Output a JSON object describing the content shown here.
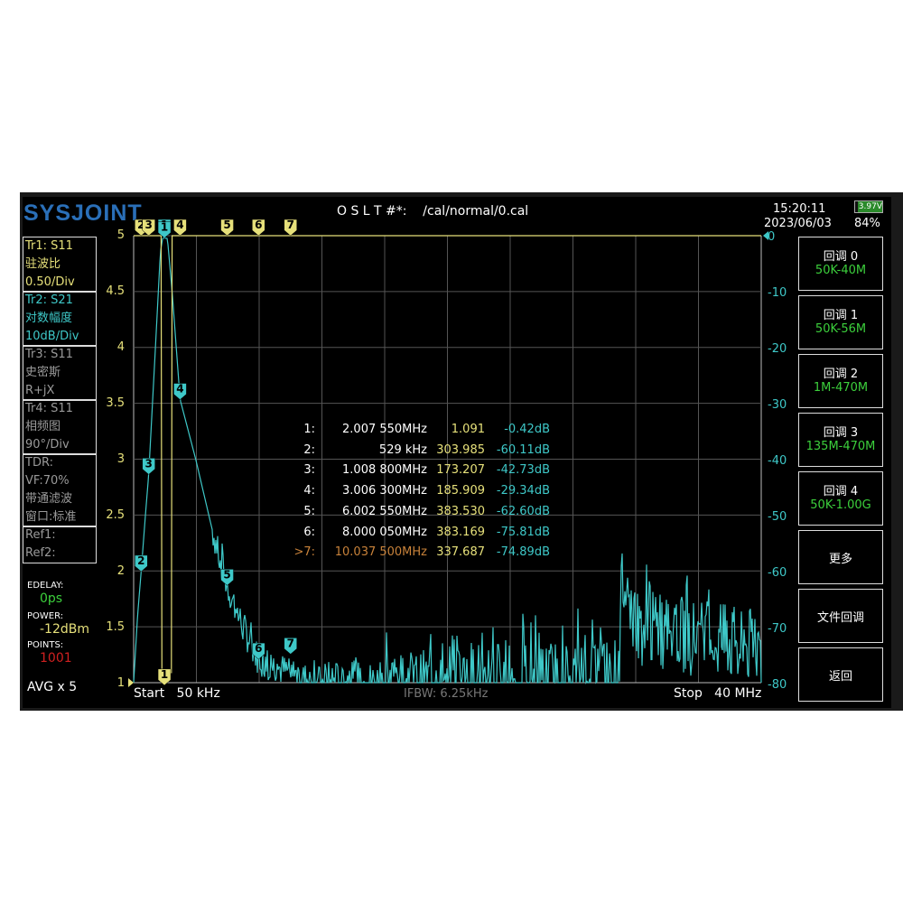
{
  "header": {
    "logo": "SYSJOINT",
    "cal_file": "O S L T #*:    /cal/normal/0.cal",
    "time": "15:20:11",
    "date": "2023/06/03",
    "battery_voltage": "3.97V",
    "battery_percent": "84%"
  },
  "traces": [
    {
      "lines": [
        "Tr1:   S11",
        "驻波比",
        "0.50/Div"
      ],
      "color": "#e6e07a"
    },
    {
      "lines": [
        "Tr2:   S21",
        "对数幅度",
        "10dB/Div"
      ],
      "color": "#3ec8c8"
    },
    {
      "lines": [
        "Tr3:   S11",
        "史密斯",
        "R+jX"
      ],
      "color": "#9a9a9a"
    },
    {
      "lines": [
        "Tr4:   S11",
        "相频图",
        "90°/Div"
      ],
      "color": "#9a9a9a"
    },
    {
      "lines": [
        "TDR:",
        "VF:70%",
        "带通滤波",
        "窗口:标准"
      ],
      "color": "#9a9a9a"
    },
    {
      "lines": [
        "Ref1:",
        "Ref2:"
      ],
      "color": "#9a9a9a"
    }
  ],
  "status": {
    "edelay_label": "EDELAY:",
    "edelay": "0ps",
    "power_label": "POWER:",
    "power": "-12dBm",
    "points_label": "POINTS:",
    "points": "1001",
    "avg": "AVG x 5"
  },
  "buttons": [
    {
      "l1": "回调 0",
      "l2": "50K-40M"
    },
    {
      "l1": "回调 1",
      "l2": "50K-56M"
    },
    {
      "l1": "回调 2",
      "l2": "1M-470M"
    },
    {
      "l1": "回调 3",
      "l2": "135M-470M"
    },
    {
      "l1": "回调 4",
      "l2": "50K-1.00G"
    },
    {
      "l1": "更多"
    },
    {
      "l1": "文件回调"
    },
    {
      "l1": "返回"
    }
  ],
  "footer": {
    "start": "Start   50 kHz",
    "ifbw": "IFBW: 6.25kHz",
    "stop": "Stop   40 MHz"
  },
  "markers": [
    {
      "id": "1:",
      "freq": "2.007 550MHz",
      "swr": "1.091",
      "db": "-0.42dB"
    },
    {
      "id": "2:",
      "freq": "529 kHz",
      "swr": "303.985",
      "db": "-60.11dB"
    },
    {
      "id": "3:",
      "freq": "1.008 800MHz",
      "swr": "173.207",
      "db": "-42.73dB"
    },
    {
      "id": "4:",
      "freq": "3.006 300MHz",
      "swr": "185.909",
      "db": "-29.34dB"
    },
    {
      "id": "5:",
      "freq": "6.002 550MHz",
      "swr": "383.530",
      "db": "-62.60dB"
    },
    {
      "id": "6:",
      "freq": "8.000 050MHz",
      "swr": "383.169",
      "db": "-75.81dB"
    },
    {
      "id": ">7:",
      "freq": "10.037 500MHz",
      "swr": "337.687",
      "db": "-74.89dB",
      "active": true
    }
  ],
  "chart_data": {
    "type": "line",
    "x_range_mhz": [
      0.05,
      40
    ],
    "left_axis": {
      "label": "SWR",
      "ticks": [
        "5",
        "4.5",
        "4",
        "3.5",
        "3",
        "2.5",
        "2",
        "1.5",
        "1"
      ],
      "ylim": [
        1,
        5
      ]
    },
    "right_axis": {
      "label": "dB",
      "ticks": [
        "0",
        "-10",
        "-20",
        "-30",
        "-40",
        "-50",
        "-60",
        "-70",
        "-80"
      ],
      "ylim": [
        -80,
        0
      ]
    },
    "marker_freqs_mhz": [
      2.00755,
      0.529,
      1.0088,
      3.0063,
      6.00255,
      8.00005,
      10.0375
    ],
    "marker_s21_db": [
      -0.42,
      -60.11,
      -42.73,
      -29.34,
      -62.6,
      -75.81,
      -74.89
    ],
    "s21_series": {
      "name": "Tr2 S21",
      "color": "#3ec8c8",
      "points": [
        [
          0.05,
          -80
        ],
        [
          0.3,
          -68
        ],
        [
          0.529,
          -60.1
        ],
        [
          0.8,
          -50
        ],
        [
          1.009,
          -42.7
        ],
        [
          1.4,
          -22
        ],
        [
          1.75,
          -3
        ],
        [
          1.9,
          -0.4
        ],
        [
          2.2,
          -0.5
        ],
        [
          2.5,
          -10
        ],
        [
          3.006,
          -29.3
        ],
        [
          4,
          -40
        ],
        [
          5,
          -52
        ],
        [
          6,
          -62.6
        ],
        [
          7,
          -70
        ],
        [
          8,
          -75.8
        ],
        [
          9,
          -77
        ],
        [
          10.5,
          -79
        ],
        [
          12,
          -80
        ],
        [
          31,
          -80
        ],
        [
          31.1,
          -61
        ],
        [
          32,
          -70
        ],
        [
          40,
          -74
        ]
      ]
    },
    "s11_series": {
      "name": "Tr1 SWR",
      "color": "#e6e07a",
      "points": [
        [
          0.05,
          5
        ],
        [
          1.8,
          5
        ],
        [
          1.85,
          1.09
        ],
        [
          2.45,
          1.09
        ],
        [
          2.5,
          5
        ],
        [
          40,
          5
        ]
      ]
    }
  }
}
